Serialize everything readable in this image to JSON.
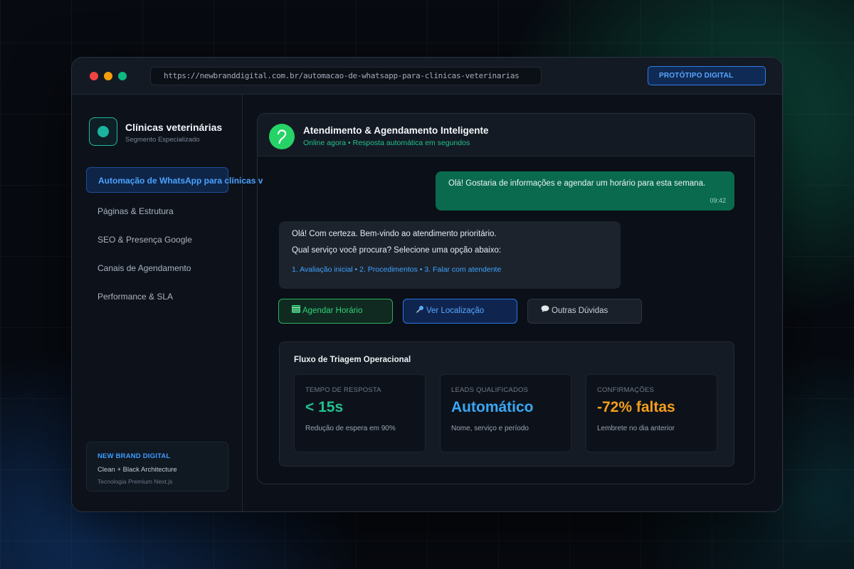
{
  "browser": {
    "url": "https://newbranddigital.com.br/automacao-de-whatsapp-para-clinicas-veterinarias",
    "badge": "PROTÓTIPO DIGITAL"
  },
  "sidebar": {
    "title": "Clínicas veterinárias",
    "subtitle": "Segmento Especializado",
    "items": [
      {
        "label": "Automação de WhatsApp para clínicas v"
      },
      {
        "label": "Páginas & Estrutura"
      },
      {
        "label": "SEO & Presença Google"
      },
      {
        "label": "Canais de Agendamento"
      },
      {
        "label": "Performance & SLA"
      }
    ],
    "footer": {
      "title": "NEW BRAND DIGITAL",
      "line": "Clean + Black Architecture",
      "small": "Tecnologia Premium Next.js"
    }
  },
  "chat": {
    "title": "Atendimento & Agendamento Inteligente",
    "status": "Online agora • Resposta automática em segundos",
    "outgoing": {
      "text": "Olá! Gostaria de informações e agendar um horário para esta semana.",
      "time": "09:42"
    },
    "incoming": {
      "line1": "Olá! Com certeza. Bem-vindo ao atendimento prioritário.",
      "line2": "Qual serviço você procura? Selecione uma opção abaixo:",
      "options": "1. Avaliação inicial • 2. Procedimentos • 3. Falar com atendente"
    },
    "buttons": [
      {
        "icon": "calendar-icon",
        "label": "Agendar Horário"
      },
      {
        "icon": "pin-icon",
        "label": "Ver Localização"
      },
      {
        "icon": "speech-bubble-icon",
        "label": "Outras Dúvidas"
      }
    ]
  },
  "flow": {
    "title": "Fluxo de Triagem Operacional",
    "metrics": [
      {
        "label": "TEMPO DE RESPOSTA",
        "value": "< 15s",
        "desc": "Redução de espera em 90%",
        "color": "#22c08e"
      },
      {
        "label": "LEADS QUALIFICADOS",
        "value": "Automático",
        "desc": "Nome, serviço e período",
        "color": "#3aa7f5"
      },
      {
        "label": "CONFIRMAÇÕES",
        "value": "-72% faltas",
        "desc": "Lembrete no dia anterior",
        "color": "#f59e1b"
      }
    ]
  },
  "colors": {
    "accent_green": "#25d366",
    "accent_blue": "#3d9dff",
    "accent_orange": "#f59e1b",
    "outgoing_bubble": "#0a6a4e"
  }
}
